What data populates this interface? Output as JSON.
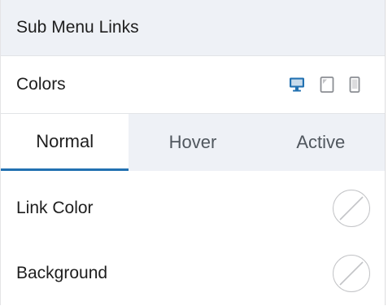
{
  "section": {
    "title": "Sub Menu Links"
  },
  "colors": {
    "label": "Colors",
    "devices": [
      {
        "icon": "desktop-icon",
        "active": true
      },
      {
        "icon": "tablet-icon",
        "active": false
      },
      {
        "icon": "mobile-icon",
        "active": false
      }
    ],
    "accent": "#2271b1"
  },
  "tabs": [
    {
      "label": "Normal",
      "active": true
    },
    {
      "label": "Hover",
      "active": false
    },
    {
      "label": "Active",
      "active": false
    }
  ],
  "fields": [
    {
      "label": "Link Color",
      "value": ""
    },
    {
      "label": "Background",
      "value": ""
    }
  ]
}
